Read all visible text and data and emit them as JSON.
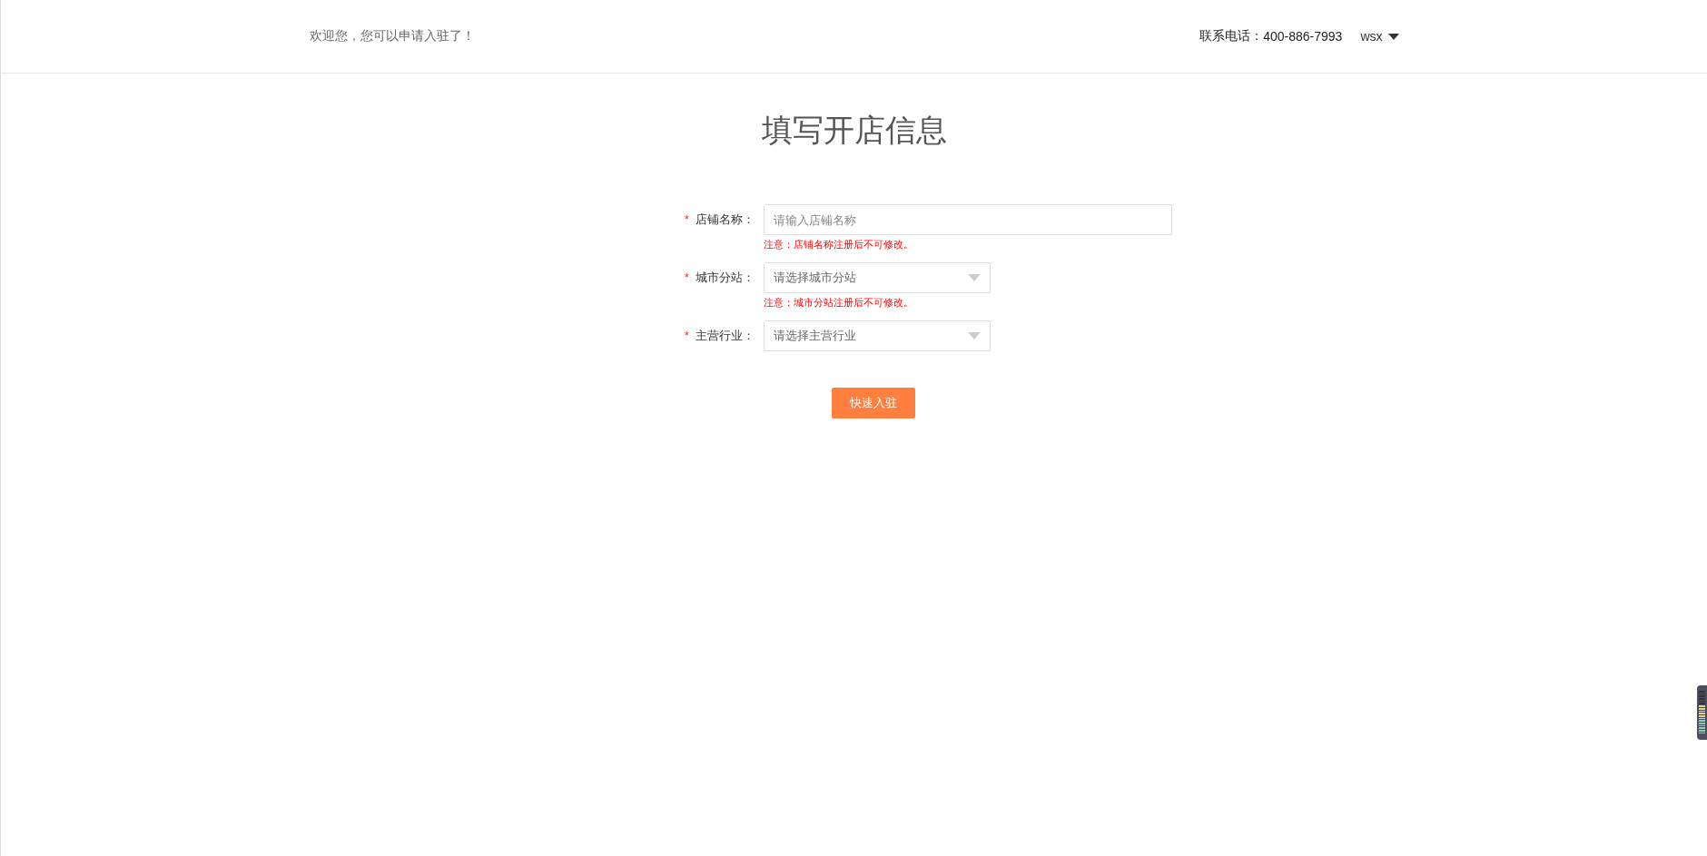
{
  "header": {
    "welcome": "欢迎您，您可以申请入驻了！",
    "phone_label": "联系电话：",
    "phone": "400-886-7993",
    "user": "wsx"
  },
  "title": "填写开店信息",
  "fields": [
    {
      "kind": "text",
      "required_mark": "*",
      "label": "店铺名称：",
      "placeholder": "请输入店铺名称",
      "note": "注意：店铺名称注册后不可修改。"
    },
    {
      "kind": "select",
      "required_mark": "*",
      "label": "城市分站：",
      "placeholder": "请选择城市分站",
      "note": "注意：城市分站注册后不可修改。"
    },
    {
      "kind": "select",
      "required_mark": "*",
      "label": "主营行业：",
      "placeholder": "请选择主营行业"
    }
  ],
  "submit": "快速入驻"
}
